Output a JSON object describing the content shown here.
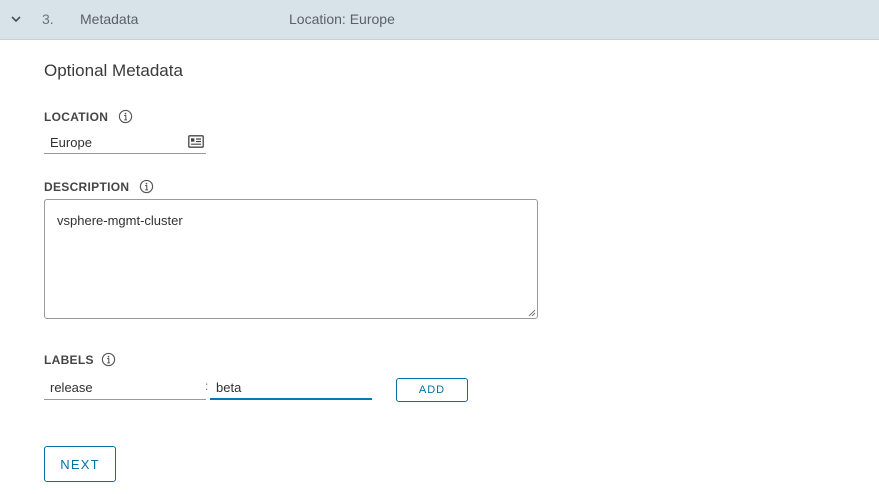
{
  "step": {
    "number": "3.",
    "title": "Metadata",
    "summary": "Location: Europe",
    "chevron_icon": "chevron-down-icon"
  },
  "section_title": "Optional Metadata",
  "location": {
    "label": "LOCATION",
    "value": "Europe",
    "info_icon": "info-icon",
    "picker_icon": "id-card-icon"
  },
  "description": {
    "label": "DESCRIPTION",
    "value": "vsphere-mgmt-cluster",
    "info_icon": "info-icon"
  },
  "labels": {
    "label": "LABELS",
    "key_value": "release",
    "separator": ":",
    "value_value": "beta",
    "add_label": "ADD",
    "info_icon": "info-icon"
  },
  "next_label": "NEXT",
  "colors": {
    "header_bg": "#d8e3e9",
    "accent": "#0072a3",
    "focus_underline": "#0079b8"
  }
}
